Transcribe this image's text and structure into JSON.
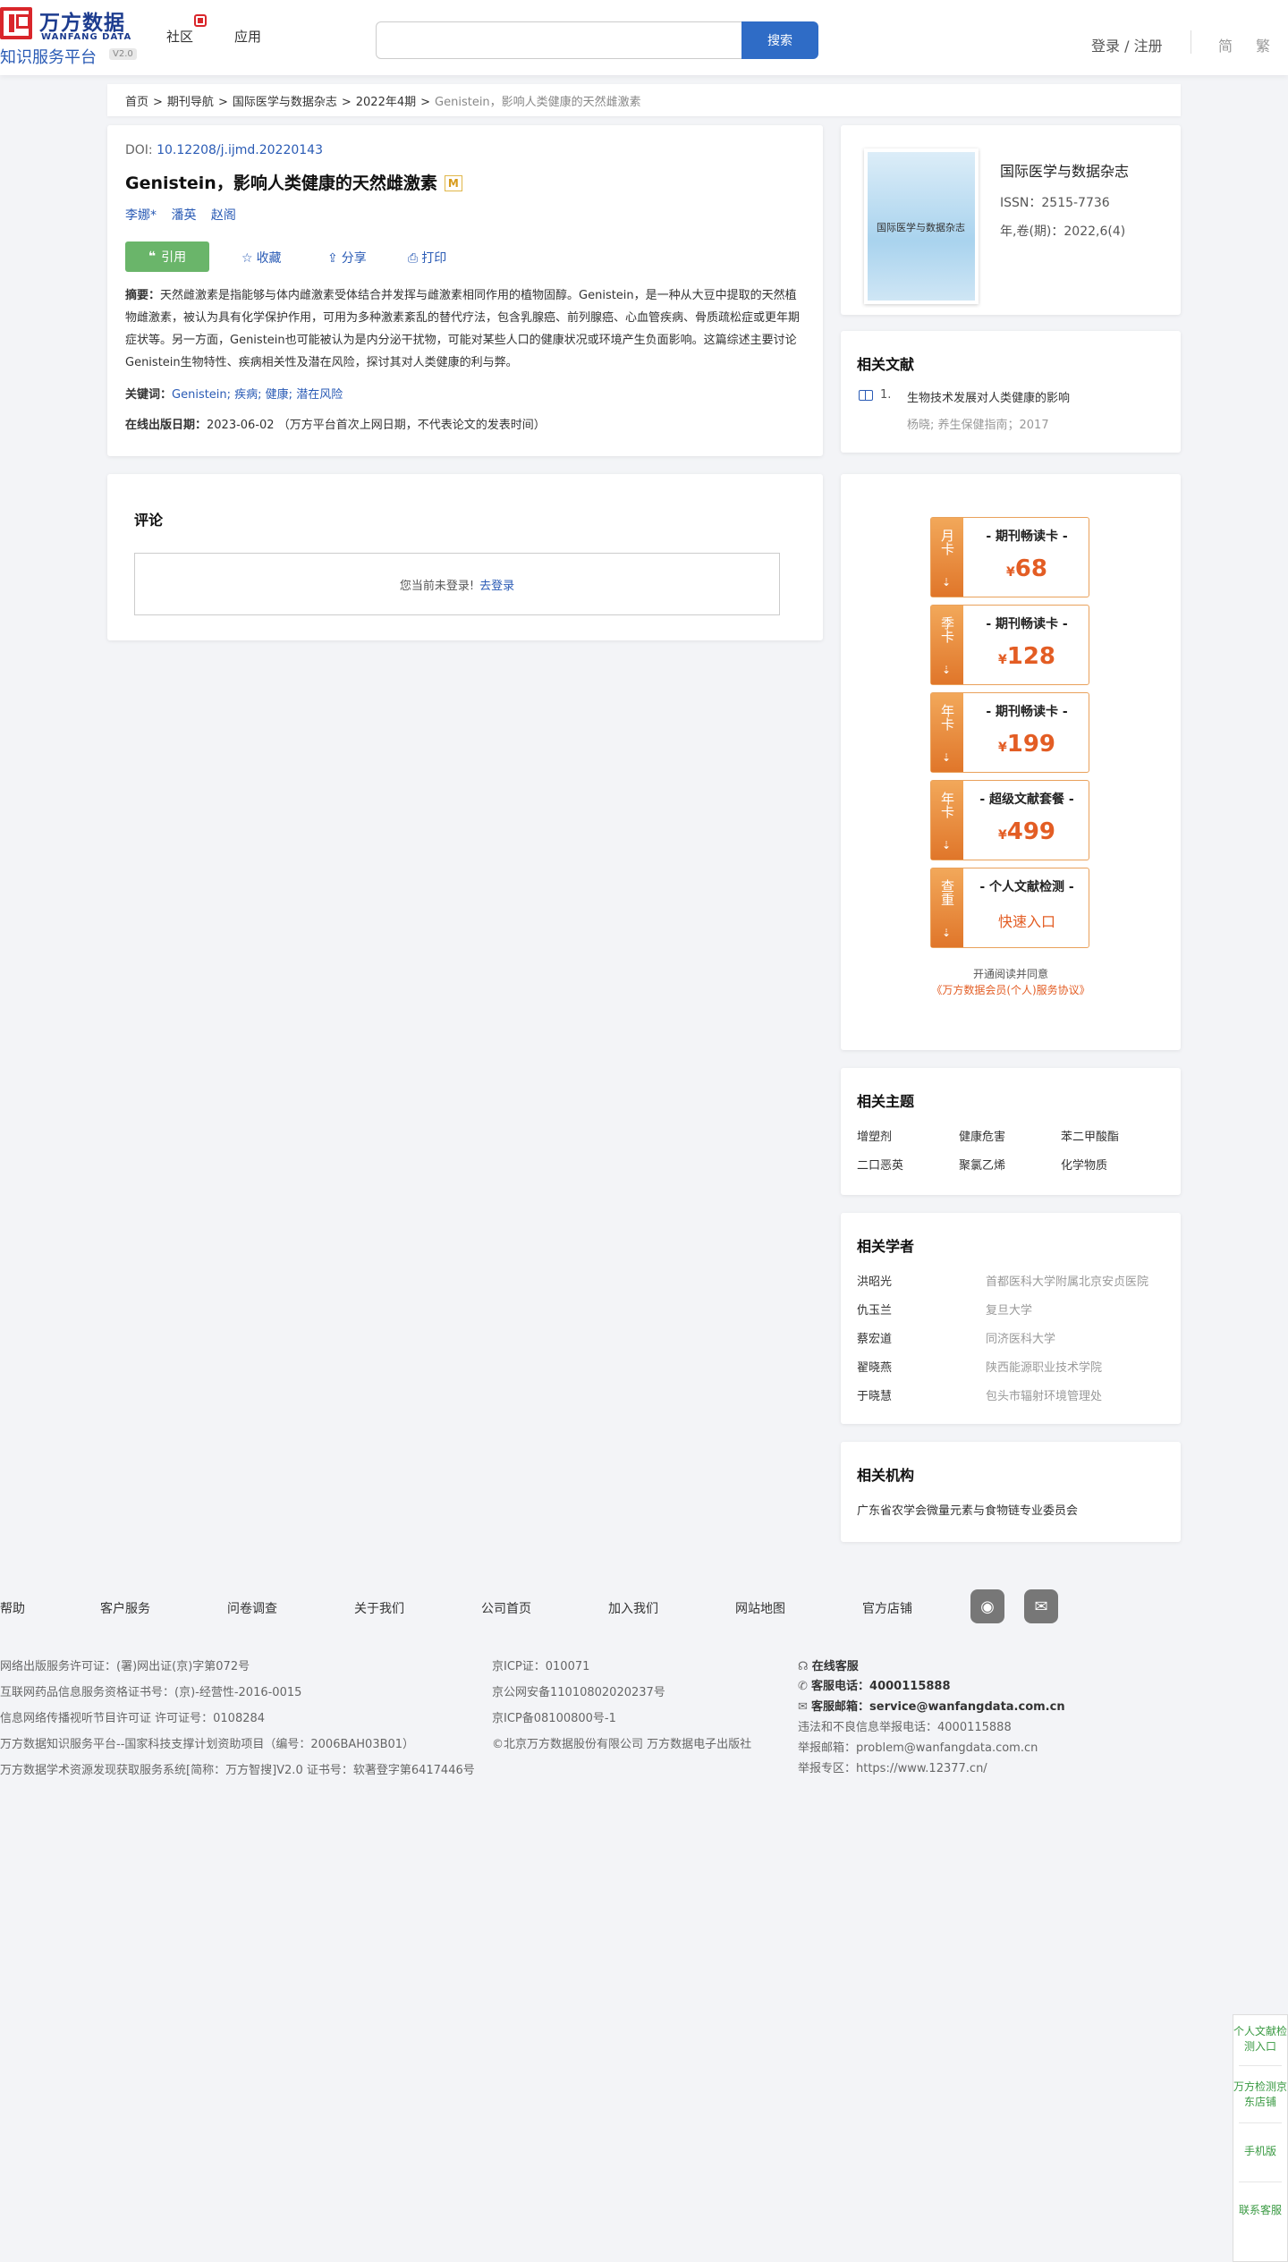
{
  "header": {
    "logo_cn": "万方数据",
    "logo_en": "WANFANG DATA",
    "logo_sub": "知识服务平台",
    "logo_ver": "V2.0",
    "nav": [
      "社区",
      "应用"
    ],
    "search_placeholder": "",
    "search_button": "搜索",
    "login": "登录 / 注册",
    "lang_simplified": "简",
    "lang_traditional": "繁"
  },
  "breadcrumb": {
    "items": [
      "首页",
      "期刊导航",
      "国际医学与数据杂志",
      "2022年4期"
    ],
    "current": "Genistein，影响人类健康的天然雌激素",
    "sep": ">"
  },
  "article": {
    "doi_label": "DOI:",
    "doi": "10.12208/j.ijmd.20220143",
    "title": "Genistein，影响人类健康的天然雌激素",
    "badge": "M",
    "authors": [
      "李娜*",
      "潘英",
      "赵阁"
    ],
    "cite_label": "引用",
    "favorite_label": "收藏",
    "share_label": "分享",
    "print_label": "打印",
    "abstract_label": "摘要：",
    "abstract": "天然雌激素是指能够与体内雌激素受体结合并发挥与雌激素相同作用的植物固醇。Genistein，是一种从大豆中提取的天然植物雌激素，被认为具有化学保护作用，可用为多种激素紊乱的替代疗法，包含乳腺癌、前列腺癌、心血管疾病、骨质疏松症或更年期症状等。另一方面，Genistein也可能被认为是内分泌干扰物，可能对某些人口的健康状况或环境产生负面影响。这篇综述主要讨论Genistein生物特性、疾病相关性及潜在风险，探讨其对人类健康的利与弊。",
    "keywords_label": "关键词：",
    "keywords": "Genistein; 疾病; 健康; 潜在风险",
    "pubdate_label": "在线出版日期：",
    "pubdate": "2023-06-02 （万方平台首次上网日期，不代表论文的发表时间）"
  },
  "comments": {
    "title": "评论",
    "not_logged_in": "您当前未登录!",
    "login_link": "去登录"
  },
  "journal": {
    "cover_text": "国际医学与数据杂志",
    "name": "国际医学与数据杂志",
    "issn": "ISSN：2515-7736",
    "volume": "年,卷(期)：2022,6(4)"
  },
  "related_docs": {
    "title": "相关文献",
    "items": [
      {
        "num": "1.",
        "title": "生物技术发展对人类健康的影响",
        "meta": "杨晓; 养生保健指南；2017"
      }
    ]
  },
  "membership": {
    "cards": [
      {
        "side": "月卡",
        "name": "- 期刊畅读卡 -",
        "currency": "¥",
        "price": "68"
      },
      {
        "side": "季卡",
        "name": "- 期刊畅读卡 -",
        "currency": "¥",
        "price": "128"
      },
      {
        "side": "年卡",
        "name": "- 期刊畅读卡 -",
        "currency": "¥",
        "price": "199"
      },
      {
        "side": "年卡",
        "name": "- 超级文献套餐 -",
        "currency": "¥",
        "price": "499"
      },
      {
        "side": "查重",
        "name": "- 个人文献检测 -",
        "link": "快速入口"
      }
    ],
    "agree_text": "开通阅读并同意",
    "agree_link": "《万方数据会员(个人)服务协议》"
  },
  "topics": {
    "title": "相关主题",
    "items": [
      "增塑剂",
      "健康危害",
      "苯二甲酸酯",
      "二口恶英",
      "聚氯乙烯",
      "化学物质"
    ]
  },
  "scholars": {
    "title": "相关学者",
    "items": [
      {
        "name": "洪昭光",
        "org": "首都医科大学附属北京安贞医院"
      },
      {
        "name": "仇玉兰",
        "org": "复旦大学"
      },
      {
        "name": "蔡宏道",
        "org": "同济医科大学"
      },
      {
        "name": "翟晓燕",
        "org": "陕西能源职业技术学院"
      },
      {
        "name": "于晓慧",
        "org": "包头市辐射环境管理处"
      }
    ]
  },
  "institutions": {
    "title": "相关机构",
    "items": [
      "广东省农学会微量元素与食物链专业委员会"
    ]
  },
  "footer": {
    "links": [
      "帮助",
      "客户服务",
      "问卷调查",
      "关于我们",
      "公司首页",
      "加入我们",
      "网站地图",
      "官方店铺"
    ],
    "social": [
      "weibo-icon",
      "wechat-icon"
    ],
    "col1": [
      "网络出版服务许可证：(署)网出证(京)字第072号",
      "互联网药品信息服务资格证书号：(京)-经营性-2016-0015",
      "信息网络传播视听节目许可证 许可证号：0108284",
      "万方数据知识服务平台--国家科技支撑计划资助项目（编号：2006BAH03B01）",
      "万方数据学术资源发现获取服务系统[简称：万方智搜]V2.0 证书号：软著登字第6417446号"
    ],
    "col2": [
      "京ICP证：010071",
      "京公网安备11010802020237号",
      "京ICP备08100800号-1",
      "©北京万方数据股份有限公司 万方数据电子出版社"
    ],
    "online_service": "在线客服",
    "phone_label": "客服电话：",
    "phone": "4000115888",
    "email_label": "客服邮箱：",
    "email": "service@wanfangdata.com.cn",
    "report_phone": "违法和不良信息举报电话：4000115888",
    "report_email": "举报邮箱：problem@wanfangdata.com.cn",
    "report_zone": "举报专区：https://www.12377.cn/"
  },
  "float_bar": {
    "items": [
      "个人文献检测入口",
      "万方检测京东店铺",
      "手机版",
      "联系客服"
    ]
  }
}
